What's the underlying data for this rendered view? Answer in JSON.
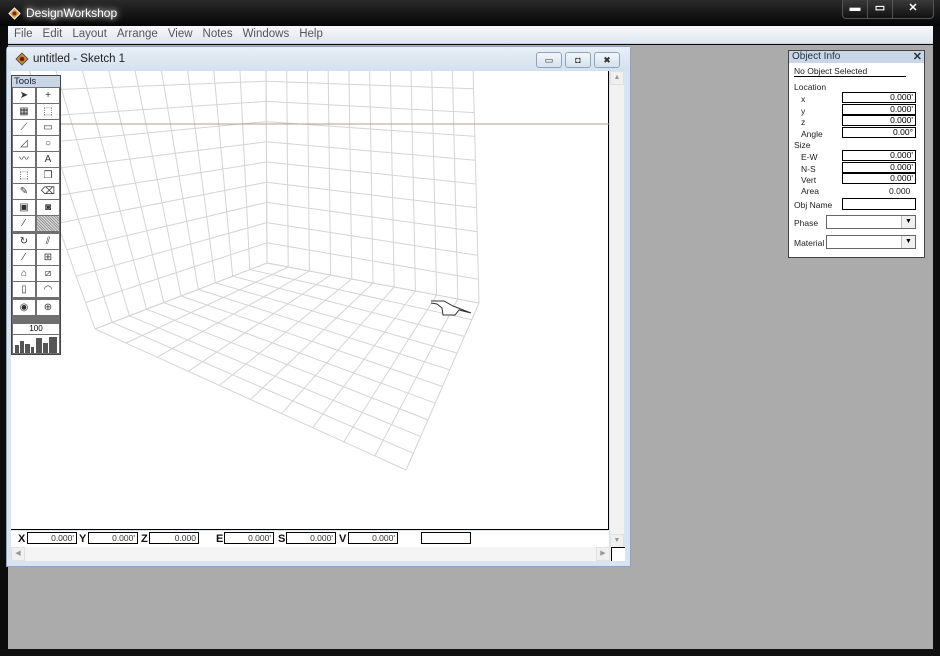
{
  "app": {
    "title": "DesignWorkshop",
    "caption_buttons": {
      "minimize": "▬",
      "maximize": "▭",
      "close": "✕"
    }
  },
  "menubar": {
    "items": [
      "File",
      "Edit",
      "Layout",
      "Arrange",
      "View",
      "Notes",
      "Windows",
      "Help"
    ]
  },
  "sketch_window": {
    "title": "untitled - Sketch 1",
    "buttons": {
      "minimize": "▭",
      "maximize": "◘",
      "close": "✖"
    }
  },
  "tools_palette": {
    "title": "Tools",
    "tools": [
      {
        "icon": "arrow-select-icon",
        "glyph": "➤"
      },
      {
        "icon": "crosshair-icon",
        "glyph": "+"
      },
      {
        "icon": "marquee-fill-icon",
        "glyph": "▦"
      },
      {
        "icon": "marquee-icon",
        "glyph": "⬚"
      },
      {
        "icon": "line-icon",
        "glyph": "⟋"
      },
      {
        "icon": "rectangle-icon",
        "glyph": "▭"
      },
      {
        "icon": "arc-icon",
        "glyph": "◿"
      },
      {
        "icon": "circle-icon",
        "glyph": "○"
      },
      {
        "icon": "freehand-icon",
        "glyph": "〰"
      },
      {
        "icon": "text-icon",
        "glyph": "A"
      },
      {
        "icon": "block-icon",
        "glyph": "⬚"
      },
      {
        "icon": "wall-icon",
        "glyph": "❒"
      },
      {
        "icon": "pencil-icon",
        "glyph": "✎"
      },
      {
        "icon": "eraser-icon",
        "glyph": "⌫"
      },
      {
        "icon": "window-opening-icon",
        "glyph": "▣"
      },
      {
        "icon": "door-opening-icon",
        "glyph": "◙"
      },
      {
        "icon": "eyedropper-icon",
        "glyph": "⁄"
      },
      {
        "icon": "pattern-icon",
        "glyph": "▒"
      },
      {
        "icon": "rotate-icon",
        "glyph": "↻"
      },
      {
        "icon": "plane-icon",
        "glyph": "⫽"
      },
      {
        "icon": "knife-icon",
        "glyph": "⁄"
      },
      {
        "icon": "cube-align-icon",
        "glyph": "⊞"
      },
      {
        "icon": "house-icon",
        "glyph": "⌂"
      },
      {
        "icon": "elevation-icon",
        "glyph": "⧄"
      },
      {
        "icon": "book-icon",
        "glyph": "▯"
      },
      {
        "icon": "orbit-icon",
        "glyph": "◠"
      },
      {
        "icon": "eye-icon",
        "glyph": "◉"
      },
      {
        "icon": "target-icon",
        "glyph": "⊕"
      }
    ],
    "zoom_level": "100"
  },
  "coordinates": {
    "fields": [
      {
        "label": "X",
        "value": "0.000'"
      },
      {
        "label": "Y",
        "value": "0.000'"
      },
      {
        "label": "Z",
        "value": "0.000"
      },
      {
        "label": "E",
        "value": "0.000'"
      },
      {
        "label": "S",
        "value": "0.000'"
      },
      {
        "label": "V",
        "value": "0.000'"
      }
    ],
    "extra_field": ""
  },
  "object_info": {
    "title": "Object Info",
    "close": "✕",
    "selection": "No Object Selected",
    "location_label": "Location",
    "location": [
      {
        "label": "x",
        "value": "0.000'"
      },
      {
        "label": "y",
        "value": "0.000'"
      },
      {
        "label": "z",
        "value": "0.000'"
      },
      {
        "label": "Angle",
        "value": "0.00°"
      }
    ],
    "size_label": "Size",
    "size": [
      {
        "label": "E-W",
        "value": "0.000'"
      },
      {
        "label": "N-S",
        "value": "0.000'"
      },
      {
        "label": "Vert",
        "value": "0.000'"
      }
    ],
    "area_label": "Area",
    "area_value": "0.000",
    "obj_name_label": "Obj Name",
    "obj_name_value": "",
    "phase_label": "Phase",
    "phase_value": "",
    "material_label": "Material",
    "material_value": ""
  },
  "scroll": {
    "up": "▲",
    "down": "▼",
    "left": "◀",
    "right": "▶"
  }
}
